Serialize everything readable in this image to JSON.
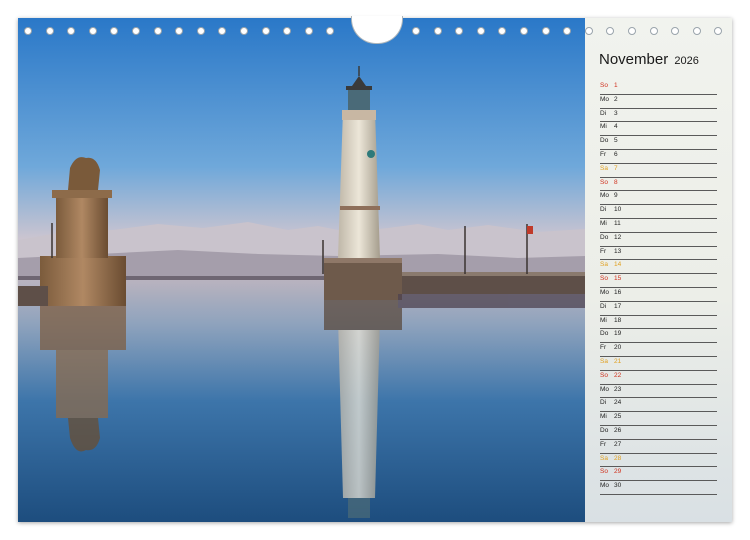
{
  "calendar": {
    "month": "November",
    "year": "2026"
  },
  "days": [
    {
      "dn": "So",
      "d": "1",
      "type": "sun"
    },
    {
      "dn": "Mo",
      "d": "2",
      "type": "wd"
    },
    {
      "dn": "Di",
      "d": "3",
      "type": "wd"
    },
    {
      "dn": "Mi",
      "d": "4",
      "type": "wd"
    },
    {
      "dn": "Do",
      "d": "5",
      "type": "wd"
    },
    {
      "dn": "Fr",
      "d": "6",
      "type": "wd"
    },
    {
      "dn": "Sa",
      "d": "7",
      "type": "sat"
    },
    {
      "dn": "So",
      "d": "8",
      "type": "sun"
    },
    {
      "dn": "Mo",
      "d": "9",
      "type": "wd"
    },
    {
      "dn": "Di",
      "d": "10",
      "type": "wd"
    },
    {
      "dn": "Mi",
      "d": "11",
      "type": "wd"
    },
    {
      "dn": "Do",
      "d": "12",
      "type": "wd"
    },
    {
      "dn": "Fr",
      "d": "13",
      "type": "wd"
    },
    {
      "dn": "Sa",
      "d": "14",
      "type": "sat"
    },
    {
      "dn": "So",
      "d": "15",
      "type": "sun"
    },
    {
      "dn": "Mo",
      "d": "16",
      "type": "wd"
    },
    {
      "dn": "Di",
      "d": "17",
      "type": "wd"
    },
    {
      "dn": "Mi",
      "d": "18",
      "type": "wd"
    },
    {
      "dn": "Do",
      "d": "19",
      "type": "wd"
    },
    {
      "dn": "Fr",
      "d": "20",
      "type": "wd"
    },
    {
      "dn": "Sa",
      "d": "21",
      "type": "sat"
    },
    {
      "dn": "So",
      "d": "22",
      "type": "sun"
    },
    {
      "dn": "Mo",
      "d": "23",
      "type": "wd"
    },
    {
      "dn": "Di",
      "d": "24",
      "type": "wd"
    },
    {
      "dn": "Mi",
      "d": "25",
      "type": "wd"
    },
    {
      "dn": "Do",
      "d": "26",
      "type": "wd"
    },
    {
      "dn": "Fr",
      "d": "27",
      "type": "wd"
    },
    {
      "dn": "Sa",
      "d": "28",
      "type": "sat"
    },
    {
      "dn": "So",
      "d": "29",
      "type": "sun"
    },
    {
      "dn": "Mo",
      "d": "30",
      "type": "wd"
    }
  ],
  "colors": {
    "sunday": "#d0301c",
    "saturday": "#e0a020",
    "weekday": "#222222",
    "sky_top": "#2a78c8",
    "water": "#1f4f80"
  },
  "binding": {
    "ring_icon": "spiral-binding-ring-icon",
    "hanger_icon": "calendar-hanger-notch-icon"
  }
}
